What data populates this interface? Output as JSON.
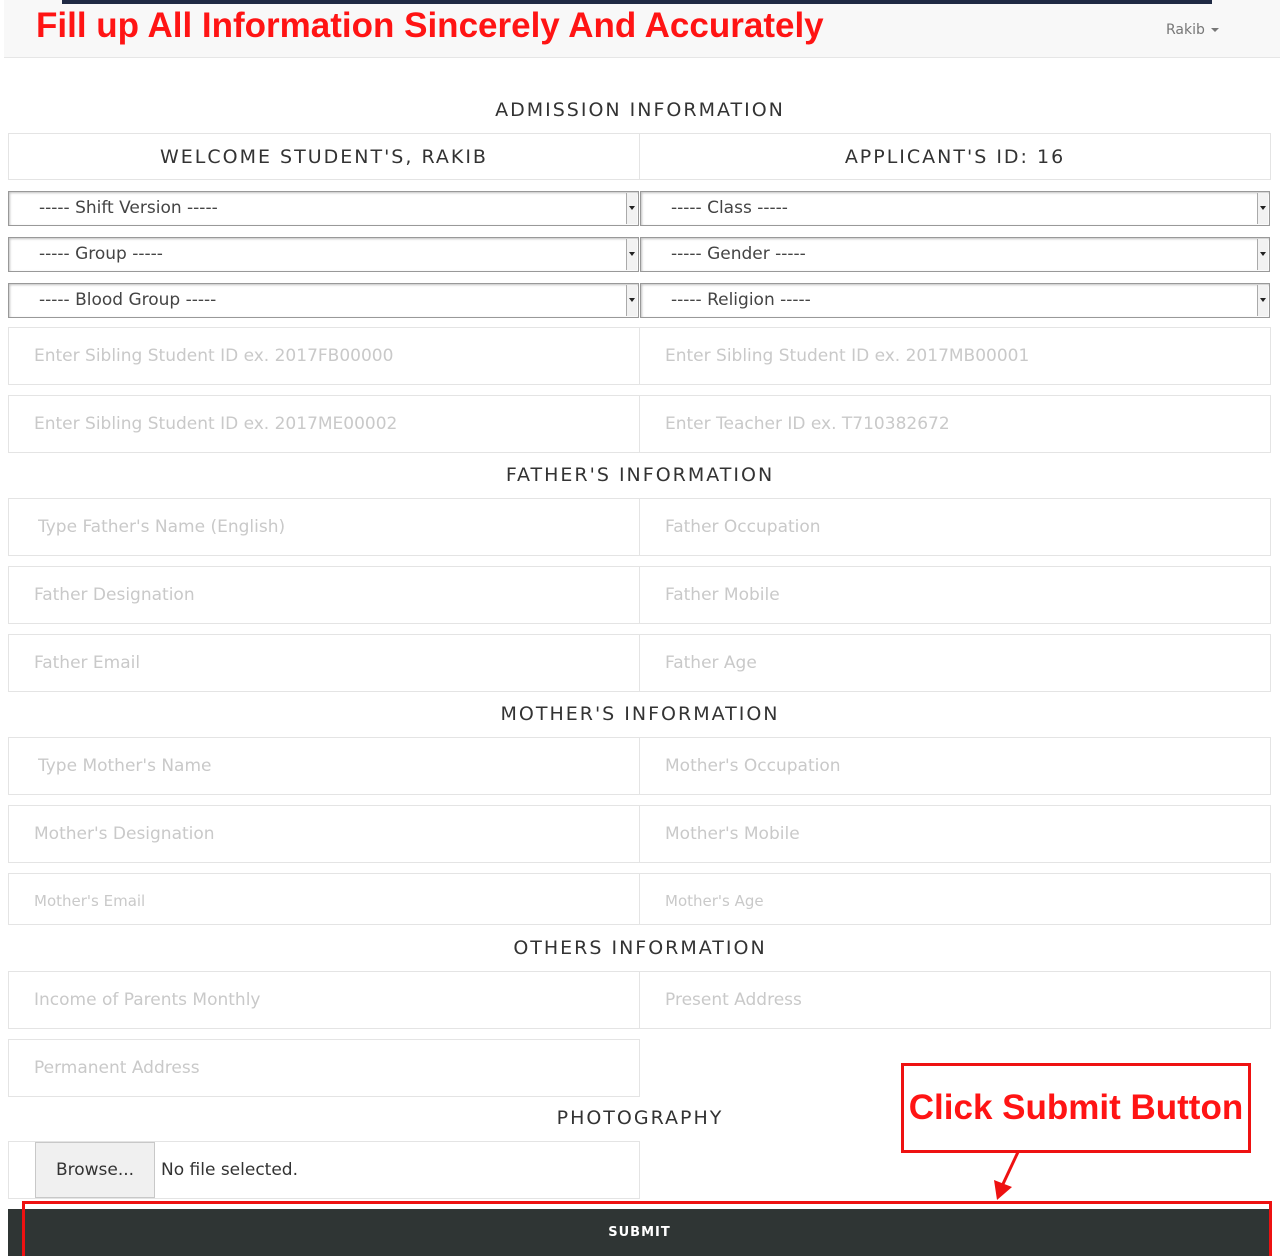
{
  "header": {
    "headline": "Fill up All Information Sincerely And Accurately",
    "user_name": "Rakib"
  },
  "admission": {
    "title": "ADMISSION INFORMATION",
    "welcome": "WELCOME STUDENT'S, RAKIB",
    "applicant_id": "APPLICANT'S ID: 16",
    "selects": {
      "shift_version": "----- Shift Version -----",
      "class": "----- Class -----",
      "group": "----- Group -----",
      "gender": "----- Gender -----",
      "blood_group": "----- Blood Group -----",
      "religion": "----- Religion -----"
    },
    "sibling_id_1_placeholder": "Enter Sibling Student ID ex. 2017FB00000",
    "sibling_id_2_placeholder": "Enter Sibling Student ID ex. 2017MB00001",
    "sibling_id_3_placeholder": "Enter Sibling Student ID ex. 2017ME00002",
    "teacher_id_placeholder": "Enter Teacher ID ex. T710382672"
  },
  "father": {
    "title": "FATHER'S INFORMATION",
    "name_placeholder": "Type Father's Name (English)",
    "occupation_placeholder": "Father Occupation",
    "designation_placeholder": "Father Designation",
    "mobile_placeholder": "Father Mobile",
    "email_placeholder": "Father Email",
    "age_placeholder": "Father Age"
  },
  "mother": {
    "title": "MOTHER'S INFORMATION",
    "name_placeholder": "Type Mother's Name",
    "occupation_placeholder": "Mother's Occupation",
    "designation_placeholder": "Mother's Designation",
    "mobile_placeholder": "Mother's Mobile",
    "email_placeholder": "Mother's Email",
    "age_placeholder": "Mother's Age"
  },
  "others": {
    "title": "OTHERS INFORMATION",
    "income_placeholder": "Income of Parents Monthly",
    "present_address_placeholder": "Present Address",
    "permanent_address_placeholder": "Permanent Address"
  },
  "photography": {
    "title": "PHOTOGRAPHY",
    "browse_label": "Browse...",
    "file_status": "No file selected."
  },
  "submit": {
    "label": "SUBMIT"
  },
  "annotation": {
    "callout": "Click Submit Button",
    "color": "#ee1111"
  },
  "colors": {
    "headline": "#ff1414",
    "submit_bg": "#2f3534"
  }
}
